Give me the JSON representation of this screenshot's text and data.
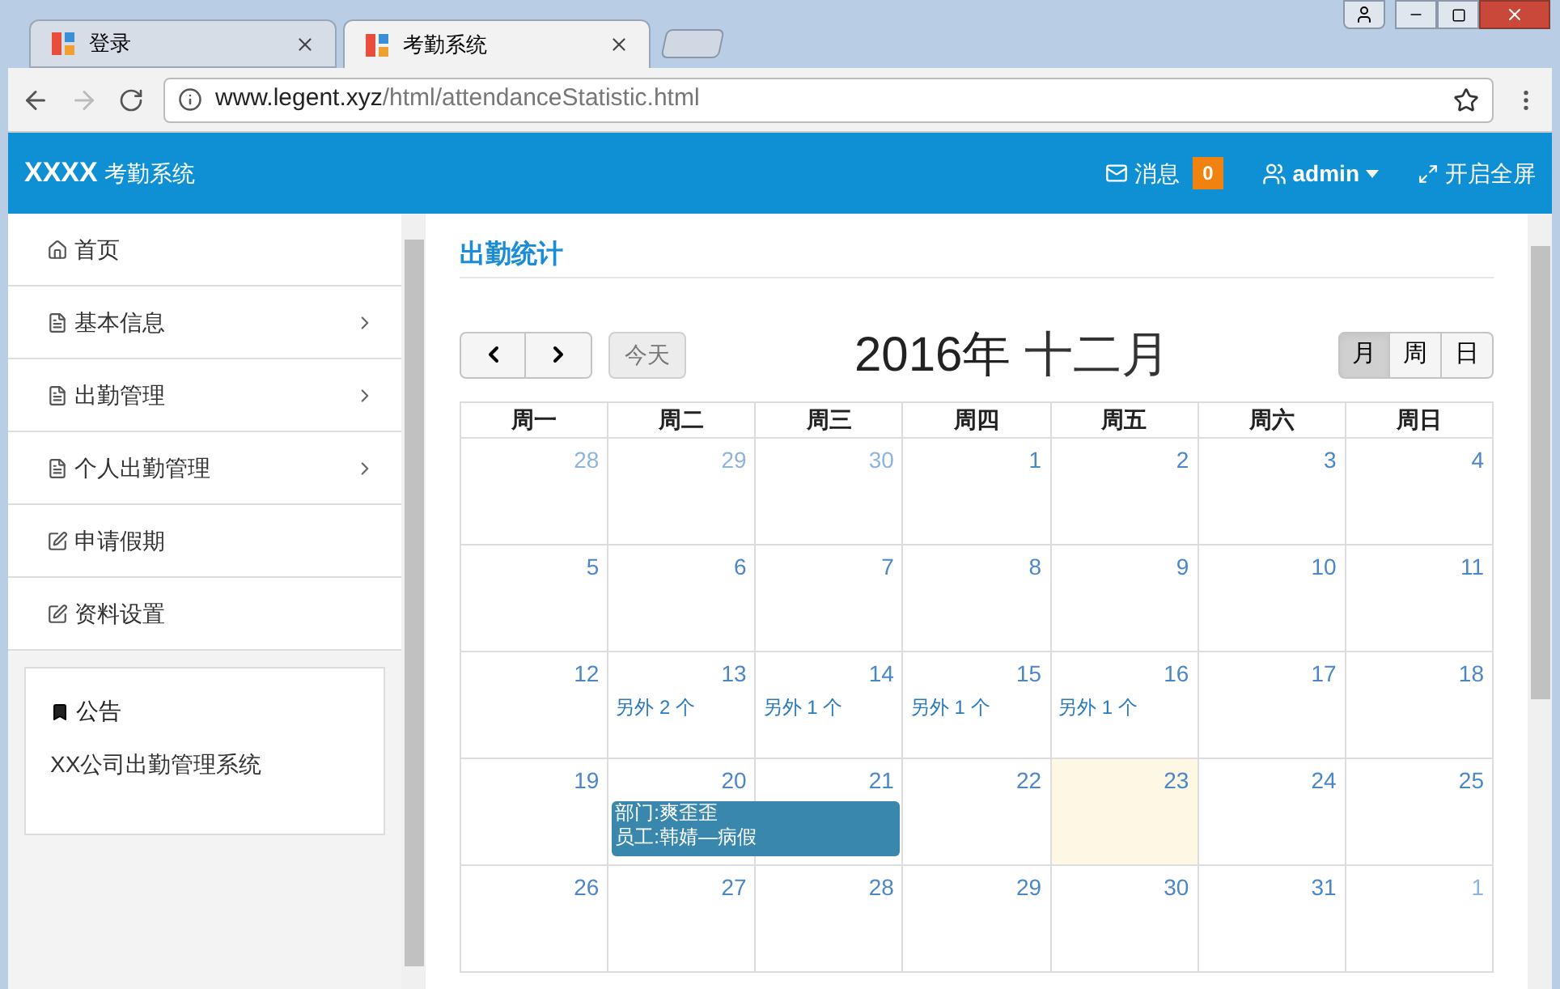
{
  "browser": {
    "tabs": [
      {
        "title": "登录",
        "selected": false
      },
      {
        "title": "考勤系统",
        "selected": true
      }
    ],
    "url_host": "www.legent.xyz",
    "url_path": "/html/attendanceStatistic.html"
  },
  "header": {
    "brand": "XXXX",
    "system": "考勤系统",
    "messages_label": "消息",
    "messages_count": "0",
    "user": "admin",
    "fullscreen": "开启全屏"
  },
  "sidebar": {
    "items": [
      {
        "label": "首页",
        "kind": "home",
        "has_arrow": false
      },
      {
        "label": "基本信息",
        "kind": "file",
        "has_arrow": true
      },
      {
        "label": "出勤管理",
        "kind": "file",
        "has_arrow": true
      },
      {
        "label": "个人出勤管理",
        "kind": "file",
        "has_arrow": true
      },
      {
        "label": "申请假期",
        "kind": "edit",
        "has_arrow": false
      },
      {
        "label": "资料设置",
        "kind": "edit",
        "has_arrow": false
      }
    ],
    "notice": {
      "title": "公告",
      "text": "XX公司出勤管理系统"
    }
  },
  "page_title": "出勤统计",
  "calendar": {
    "today_button": "今天",
    "title_year": "2016年",
    "title_month": "十二月",
    "views": [
      {
        "label": "月",
        "selected": true
      },
      {
        "label": "周",
        "selected": false
      },
      {
        "label": "日",
        "selected": false
      }
    ],
    "weekdays": [
      "周一",
      "周二",
      "周三",
      "周四",
      "周五",
      "周六",
      "周日"
    ],
    "weeks": [
      {
        "days": [
          {
            "day": "28",
            "other_month": true
          },
          {
            "day": "29",
            "other_month": true
          },
          {
            "day": "30",
            "other_month": true
          },
          {
            "day": "1"
          },
          {
            "day": "2"
          },
          {
            "day": "3"
          },
          {
            "day": "4"
          }
        ]
      },
      {
        "days": [
          {
            "day": "5"
          },
          {
            "day": "6"
          },
          {
            "day": "7"
          },
          {
            "day": "8"
          },
          {
            "day": "9"
          },
          {
            "day": "10"
          },
          {
            "day": "11"
          }
        ]
      },
      {
        "days": [
          {
            "day": "12"
          },
          {
            "day": "13",
            "more": "另外 2 个"
          },
          {
            "day": "14",
            "more": "另外 1 个"
          },
          {
            "day": "15",
            "more": "另外 1 个"
          },
          {
            "day": "16",
            "more": "另外 1 个"
          },
          {
            "day": "17"
          },
          {
            "day": "18"
          }
        ]
      },
      {
        "days": [
          {
            "day": "19"
          },
          {
            "day": "20",
            "event": {
              "lines": [
                "部门:爽歪歪",
                "员工:韩婧—病假"
              ]
            }
          },
          {
            "day": "21",
            "event_continued": true
          },
          {
            "day": "22"
          },
          {
            "day": "23",
            "today": true
          },
          {
            "day": "24"
          },
          {
            "day": "25"
          }
        ]
      },
      {
        "days": [
          {
            "day": "26"
          },
          {
            "day": "27"
          },
          {
            "day": "28"
          },
          {
            "day": "29"
          },
          {
            "day": "30"
          },
          {
            "day": "31"
          },
          {
            "day": "1",
            "other_month": true
          }
        ]
      }
    ]
  }
}
